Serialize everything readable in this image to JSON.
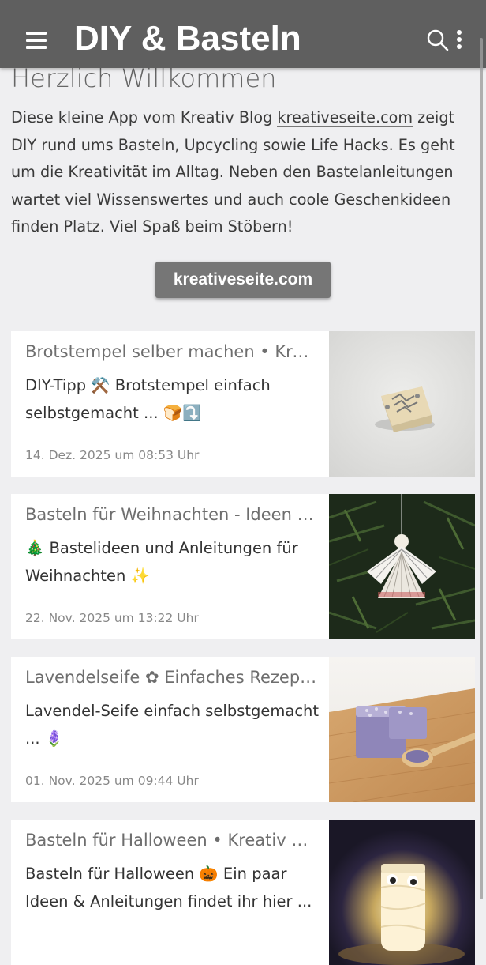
{
  "header": {
    "title": "DIY & Basteln",
    "menu_icon": "hamburger-menu-icon",
    "search_icon": "search-icon",
    "more_icon": "more-vertical-icon"
  },
  "welcome": {
    "title": "Herzlich Willkommen",
    "intro_before": "Diese kleine App vom Kreativ Blog ",
    "intro_link": "kreativeseite.com",
    "intro_after": " zeigt DIY rund ums Basteln, Upcycling sowie Life Hacks. Es geht um die Kreativität im Alltag. Neben den Bastelanleitungen wartet viel Wissenswertes und auch coole Geschenkideen finden Platz. Viel Spaß beim Stöbern!",
    "button_label": "kreativeseite.com"
  },
  "posts": [
    {
      "title": "Brotstempel selber machen • Krea...",
      "desc": "DIY-Tipp ⚒️ Brotstempel einfach selbstgemacht ... 🍞⤵️",
      "date": "14. Dez. 2025 um 08:53 Uhr"
    },
    {
      "title": "Basteln für Weihnachten - Ideen u...",
      "desc": "🎄 Bastelideen und Anleitungen für Weihnachten ✨",
      "date": "22. Nov. 2025 um 13:22 Uhr"
    },
    {
      "title": "Lavendelseife ✿ Einfaches Rezept...",
      "desc": "Lavendel-Seife einfach selbstgemacht ... 🪻",
      "date": "01. Nov. 2025 um 09:44 Uhr"
    },
    {
      "title": "Basteln für Halloween • Kreativ Bl...",
      "desc": "Basteln für Halloween 🎃 Ein paar Ideen & Anleitungen findet ihr hier ...",
      "date": ""
    }
  ],
  "colors": {
    "topbar": "#5f5f5f",
    "background": "#efeff1",
    "button": "#767676"
  }
}
